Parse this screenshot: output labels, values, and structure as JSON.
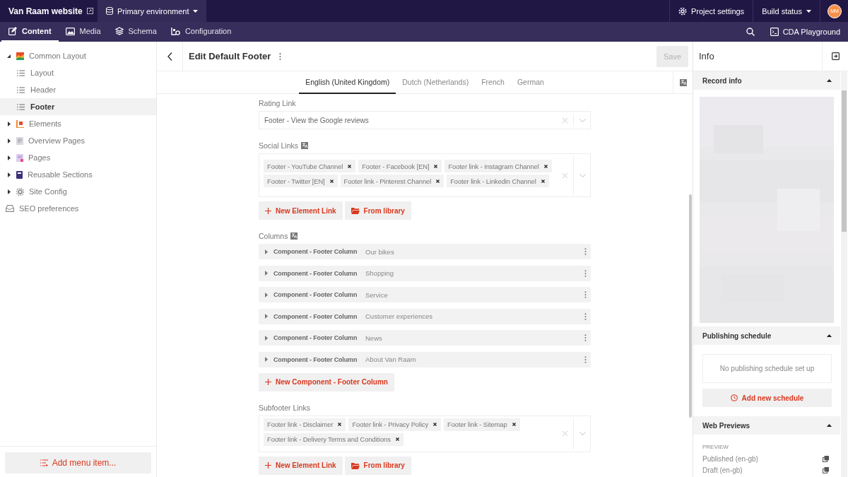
{
  "topbar": {
    "project": "Van Raam website",
    "environment": "Primary environment",
    "project_settings": "Project settings",
    "build_status": "Build status",
    "avatar": "MM"
  },
  "nav": {
    "tabs": [
      {
        "label": "Content",
        "selected": true
      },
      {
        "label": "Media",
        "selected": false
      },
      {
        "label": "Schema",
        "selected": false
      },
      {
        "label": "Configuration",
        "selected": false
      }
    ],
    "cda": "CDA Playground"
  },
  "sidebar": {
    "items": [
      {
        "label": "Common Layout",
        "expanded": true,
        "selected": false,
        "children": [
          {
            "label": "Layout",
            "selected": false
          },
          {
            "label": "Header",
            "selected": false
          },
          {
            "label": "Footer",
            "selected": true
          }
        ]
      },
      {
        "label": "Elements",
        "expanded": false,
        "selected": false
      },
      {
        "label": "Overview Pages",
        "expanded": false,
        "selected": false
      },
      {
        "label": "Pages",
        "expanded": false,
        "selected": false
      },
      {
        "label": "Reusable Sections",
        "expanded": false,
        "selected": false
      },
      {
        "label": "Site Config",
        "expanded": false,
        "selected": false
      },
      {
        "label": "SEO preferences",
        "selected": false
      }
    ],
    "add_button": "Add menu item..."
  },
  "editor": {
    "title": "Edit Default Footer",
    "save": {
      "label": "Save",
      "disabled": true
    },
    "locales": [
      {
        "label": "English (United Kingdom)",
        "selected": true
      },
      {
        "label": "Dutch (Netherlands)",
        "selected": false
      },
      {
        "label": "French",
        "selected": false
      },
      {
        "label": "German",
        "selected": false
      }
    ],
    "fields": [
      {
        "kind": "link",
        "label": "Rating Link",
        "value": "Footer - View the Google reviews"
      },
      {
        "kind": "links",
        "label": "Social Links",
        "localized": true,
        "tags": [
          "Footer - YouTube Channel",
          "Footer - Facebook [EN]",
          "Footer link - Instagram Channel",
          "Footer - Twitter [EN]",
          "Footer link - Pinterest Channel",
          "Footer link - Linkedin Channel"
        ],
        "buttons": [
          "New Element Link",
          "From library"
        ]
      },
      {
        "kind": "blocks",
        "label": "Columns",
        "localized": true,
        "blocks": [
          {
            "type": "Component - Footer Column",
            "title": "Our bikes"
          },
          {
            "type": "Component - Footer Column",
            "title": "Shopping"
          },
          {
            "type": "Component - Footer Column",
            "title": "Service"
          },
          {
            "type": "Component - Footer Column",
            "title": "Customer experiences"
          },
          {
            "type": "Component - Footer Column",
            "title": "News"
          },
          {
            "type": "Component - Footer Column",
            "title": "About Van Raam"
          }
        ],
        "button": "New Component - Footer Column"
      },
      {
        "kind": "links",
        "label": "Subfooter Links",
        "localized": false,
        "tags": [
          "Footer link - Disclaimer",
          "Footer link - Privacy Policy",
          "Footer link - Sitemap",
          "Footer link - Delivery Terms and Conditions"
        ],
        "buttons": [
          "New Element Link",
          "From library"
        ]
      }
    ]
  },
  "info": {
    "title": "Info",
    "sections": [
      {
        "kind": "record",
        "title": "Record info",
        "expanded": true
      },
      {
        "kind": "schedule",
        "title": "Publishing schedule",
        "expanded": true,
        "empty": "No publishing schedule set up",
        "button": "Add new schedule"
      },
      {
        "kind": "previews",
        "title": "Web Previews",
        "expanded": true,
        "group": "PREVIEW",
        "links": [
          "Published (en-gb)",
          "Draft (en-gb)"
        ]
      }
    ]
  }
}
